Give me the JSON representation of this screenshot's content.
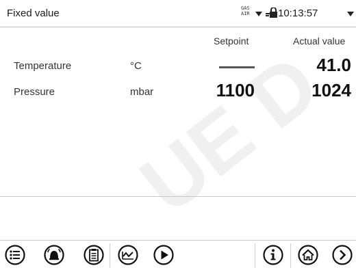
{
  "header": {
    "title": "Fixed value",
    "gas_line1": "GAS",
    "gas_line2": "AIR",
    "time": "10:13:57"
  },
  "columns": {
    "setpoint": "Setpoint",
    "actual": "Actual value"
  },
  "rows": [
    {
      "label": "Temperature",
      "unit": "°C",
      "setpoint": "",
      "actual": "41.0"
    },
    {
      "label": "Pressure",
      "unit": "mbar",
      "setpoint": "1100",
      "actual": "1024"
    }
  ],
  "watermark": "UE D",
  "toolbar": {
    "icons": [
      "menu-icon",
      "alarm-icon",
      "clipboard-icon",
      "chart-icon",
      "play-icon",
      "info-icon",
      "home-icon",
      "forward-icon"
    ]
  }
}
